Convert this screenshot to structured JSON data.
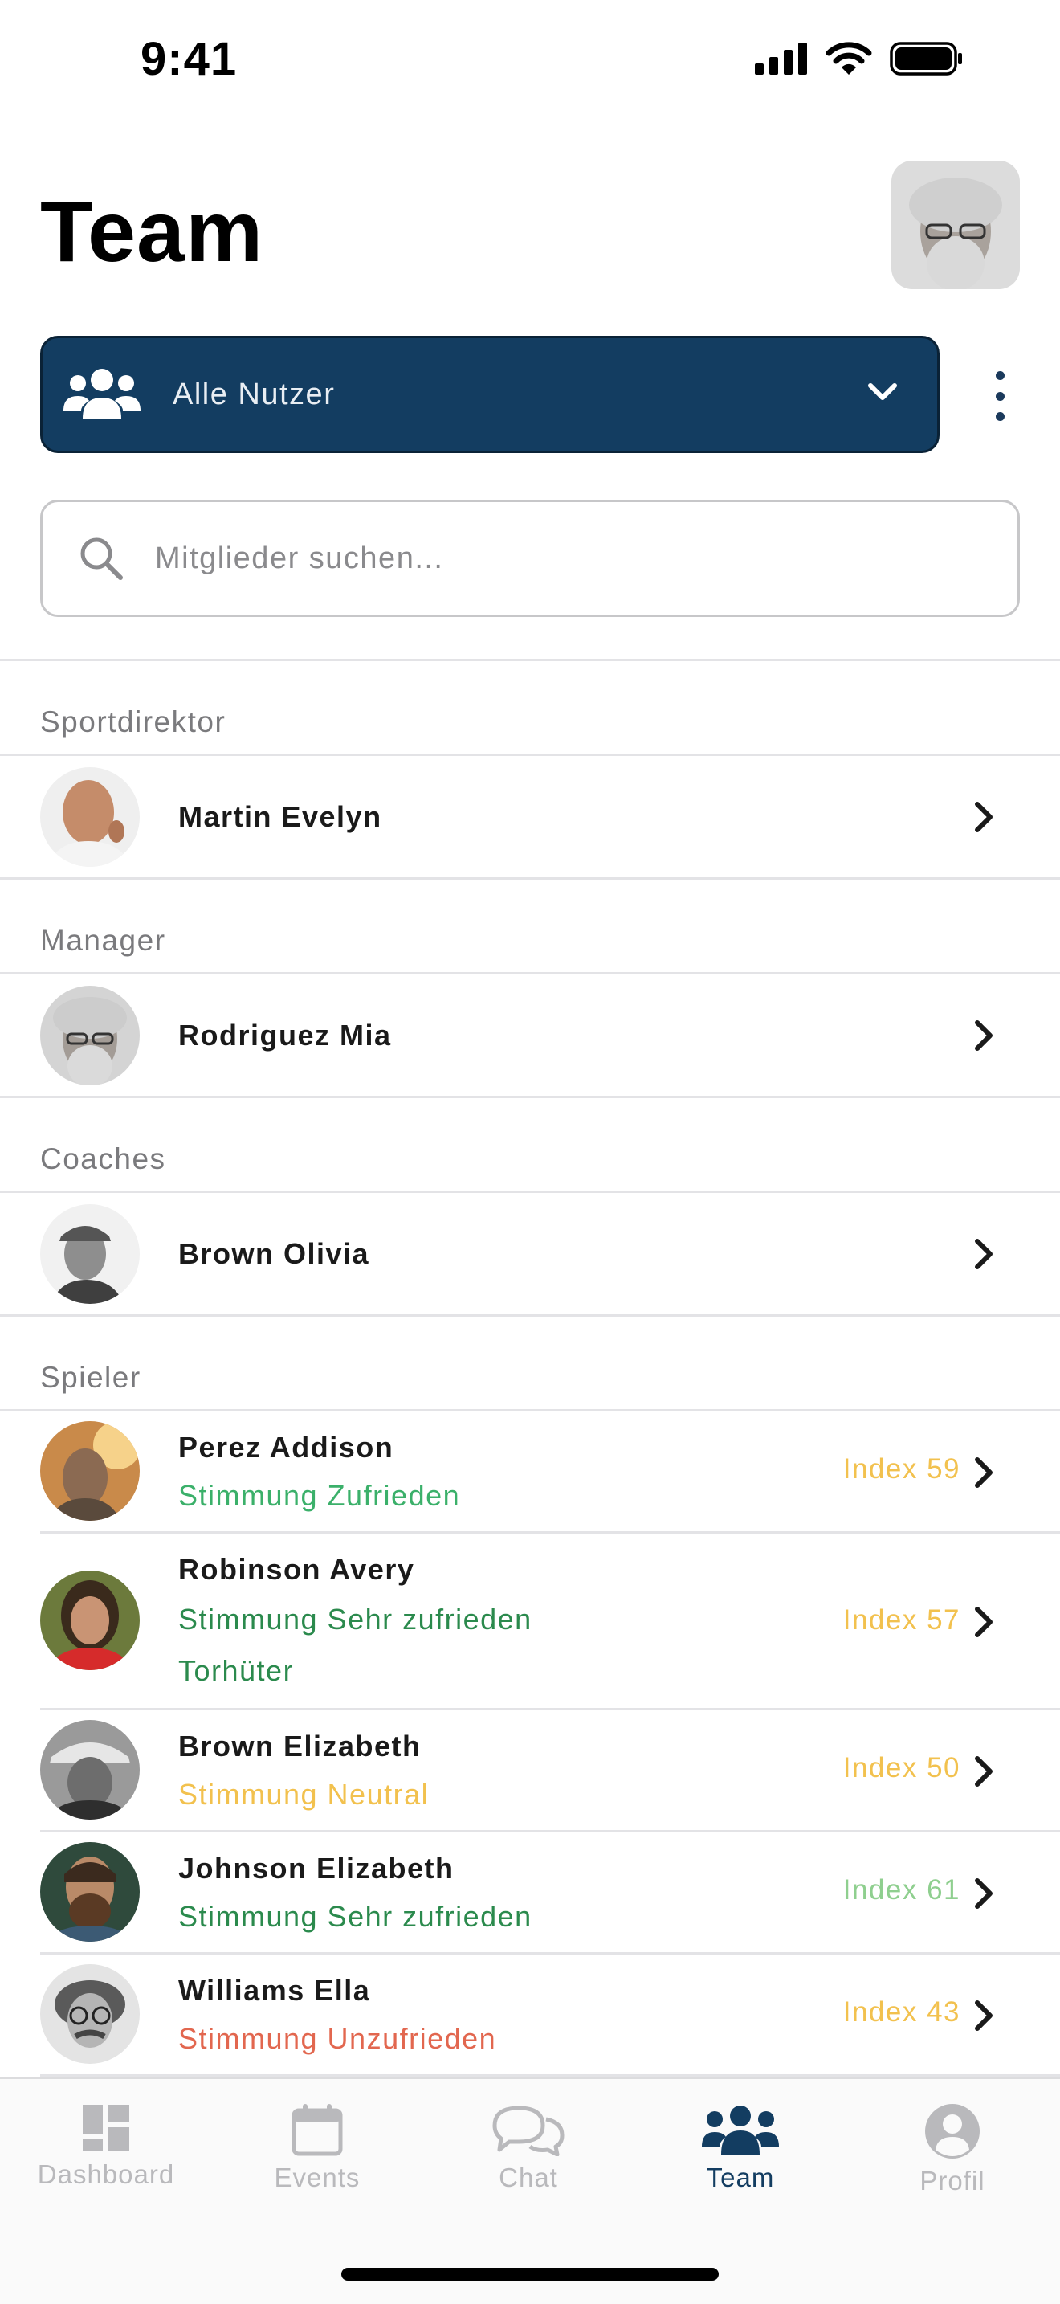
{
  "status_bar": {
    "time": "9:41"
  },
  "header": {
    "title": "Team"
  },
  "filter": {
    "label": "Alle Nutzer"
  },
  "search": {
    "placeholder": "Mitglieder suchen..."
  },
  "sections": {
    "sportdirektor": {
      "title": "Sportdirektor",
      "name": "Martin Evelyn"
    },
    "manager": {
      "title": "Manager",
      "name": "Rodriguez Mia"
    },
    "coaches": {
      "title": "Coaches",
      "name": "Brown Olivia"
    },
    "spieler": {
      "title": "Spieler",
      "players": [
        {
          "name": "Perez Addison",
          "mood": "Stimmung Zufrieden",
          "mood_color": "#3bb06a",
          "index": "Index 59",
          "index_color": "#f2c14e"
        },
        {
          "name": "Robinson Avery",
          "mood": "Stimmung Sehr zufrieden",
          "mood_color": "#2b8a4d",
          "position": "Torhüter",
          "index": "Index 57",
          "index_color": "#f2c14e"
        },
        {
          "name": "Brown Elizabeth",
          "mood": "Stimmung Neutral",
          "mood_color": "#f2c14e",
          "index": "Index 50",
          "index_color": "#f2c14e"
        },
        {
          "name": "Johnson Elizabeth",
          "mood": "Stimmung Sehr zufrieden",
          "mood_color": "#2b8a4d",
          "index": "Index 61",
          "index_color": "#8fcf8f"
        },
        {
          "name": "Williams Ella",
          "mood": "Stimmung Unzufrieden",
          "mood_color": "#e2674f",
          "index": "Index 43",
          "index_color": "#f2c14e"
        }
      ]
    }
  },
  "tabs": [
    {
      "label": "Dashboard",
      "icon": "dashboard-icon"
    },
    {
      "label": "Events",
      "icon": "calendar-icon"
    },
    {
      "label": "Chat",
      "icon": "chat-icon"
    },
    {
      "label": "Team",
      "icon": "team-icon",
      "active": true
    },
    {
      "label": "Profil",
      "icon": "profile-icon"
    }
  ],
  "colors": {
    "primary": "#133d61",
    "inactive": "#b9b9bc"
  }
}
